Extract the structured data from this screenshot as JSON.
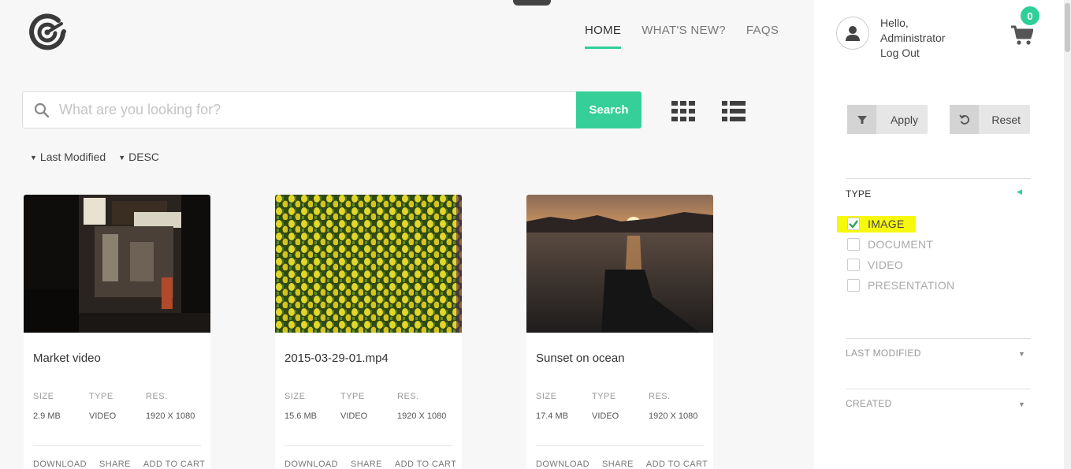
{
  "nav": {
    "items": [
      {
        "label": "HOME",
        "active": true
      },
      {
        "label": "WHAT'S NEW?"
      },
      {
        "label": "FAQS"
      }
    ]
  },
  "search": {
    "placeholder": "What are you looking for?",
    "button_label": "Search"
  },
  "sort": {
    "field": "Last Modified",
    "order": "DESC"
  },
  "cards": [
    {
      "title": "Market video",
      "size_label": "SIZE",
      "size": "2.9 MB",
      "type_label": "TYPE",
      "type": "VIDEO",
      "res_label": "RES.",
      "res": "1920 X 1080",
      "download": "DOWNLOAD",
      "share": "SHARE",
      "cart": "ADD TO CART"
    },
    {
      "title": "2015-03-29-01.mp4",
      "size_label": "SIZE",
      "size": "15.6 MB",
      "type_label": "TYPE",
      "type": "VIDEO",
      "res_label": "RES.",
      "res": "1920 X 1080",
      "download": "DOWNLOAD",
      "share": "SHARE",
      "cart": "ADD TO CART"
    },
    {
      "title": "Sunset on ocean",
      "size_label": "SIZE",
      "size": "17.4 MB",
      "type_label": "TYPE",
      "type": "VIDEO",
      "res_label": "RES.",
      "res": "1920 X 1080",
      "download": "DOWNLOAD",
      "share": "SHARE",
      "cart": "ADD TO CART"
    }
  ],
  "user": {
    "greeting": "Hello,",
    "name": "Administrator",
    "logout": "Log Out"
  },
  "cart": {
    "count": "0"
  },
  "filters": {
    "apply_label": "Apply",
    "reset_label": "Reset",
    "type_title": "TYPE",
    "types": [
      {
        "label": "IMAGE",
        "checked": true
      },
      {
        "label": "DOCUMENT",
        "checked": false
      },
      {
        "label": "VIDEO",
        "checked": false
      },
      {
        "label": "PRESENTATION",
        "checked": false
      }
    ],
    "last_modified_title": "LAST MODIFIED",
    "created_title": "CREATED"
  },
  "colors": {
    "accent": "#36cf9a",
    "highlight": "#f7f90c"
  },
  "icons": [
    "logo-icon",
    "search-icon",
    "grid-view-icon",
    "list-view-icon",
    "user-icon",
    "cart-icon",
    "filter-icon",
    "reset-icon",
    "check-icon"
  ]
}
